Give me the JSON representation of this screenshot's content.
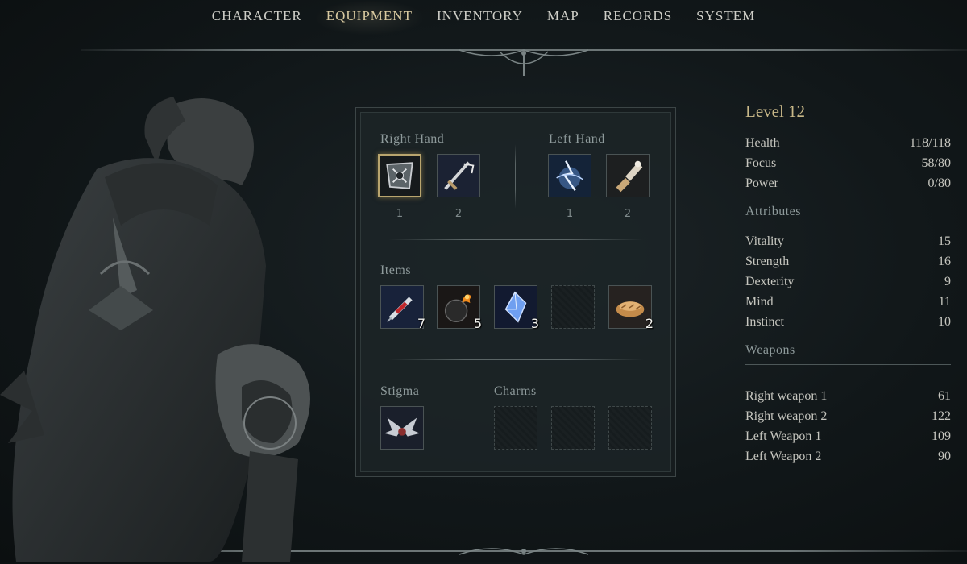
{
  "nav": {
    "tabs": [
      {
        "label": "CHARACTER",
        "active": false
      },
      {
        "label": "EQUIPMENT",
        "active": true
      },
      {
        "label": "INVENTORY",
        "active": false
      },
      {
        "label": "MAP",
        "active": false
      },
      {
        "label": "RECORDS",
        "active": false
      },
      {
        "label": "SYSTEM",
        "active": false
      }
    ]
  },
  "equipment": {
    "right_hand": {
      "label": "Right Hand",
      "slots": [
        {
          "num": "1",
          "icon": "spiked-shield-icon",
          "selected": true
        },
        {
          "num": "2",
          "icon": "sword-icon"
        }
      ]
    },
    "left_hand": {
      "label": "Left Hand",
      "slots": [
        {
          "num": "1",
          "icon": "lightning-spell-icon"
        },
        {
          "num": "2",
          "icon": "gauntlet-icon"
        }
      ]
    },
    "items": {
      "label": "Items",
      "slots": [
        {
          "icon": "healing-syringe-icon",
          "count": "7"
        },
        {
          "icon": "fire-bomb-icon",
          "count": "5"
        },
        {
          "icon": "blue-crystal-icon",
          "count": "3"
        },
        {
          "icon": "empty-slot-icon",
          "count": ""
        },
        {
          "icon": "bread-icon",
          "count": "2"
        }
      ]
    },
    "stigma": {
      "label": "Stigma",
      "icon": "winged-stigma-icon"
    },
    "charms": {
      "label": "Charms",
      "slots": [
        "empty",
        "empty",
        "empty"
      ]
    }
  },
  "stats": {
    "level": "Level 12",
    "vitals": [
      {
        "name": "Health",
        "value": "118/118"
      },
      {
        "name": "Focus",
        "value": "58/80"
      },
      {
        "name": "Power",
        "value": "0/80"
      }
    ],
    "attributes_heading": "Attributes",
    "attributes": [
      {
        "name": "Vitality",
        "value": "15"
      },
      {
        "name": "Strength",
        "value": "16"
      },
      {
        "name": "Dexterity",
        "value": "9"
      },
      {
        "name": "Mind",
        "value": "11"
      },
      {
        "name": "Instinct",
        "value": "10"
      }
    ],
    "weapons_heading": "Weapons",
    "weapons": [
      {
        "name": "Right weapon 1",
        "value": "61"
      },
      {
        "name": "Right weapon 2",
        "value": "122"
      },
      {
        "name": "Left Weapon 1",
        "value": "109"
      },
      {
        "name": "Left Weapon 2",
        "value": "90"
      }
    ]
  },
  "colors": {
    "accent": "#c8b888",
    "panel_bg": "#1c2427",
    "text": "#c6c6bf"
  }
}
